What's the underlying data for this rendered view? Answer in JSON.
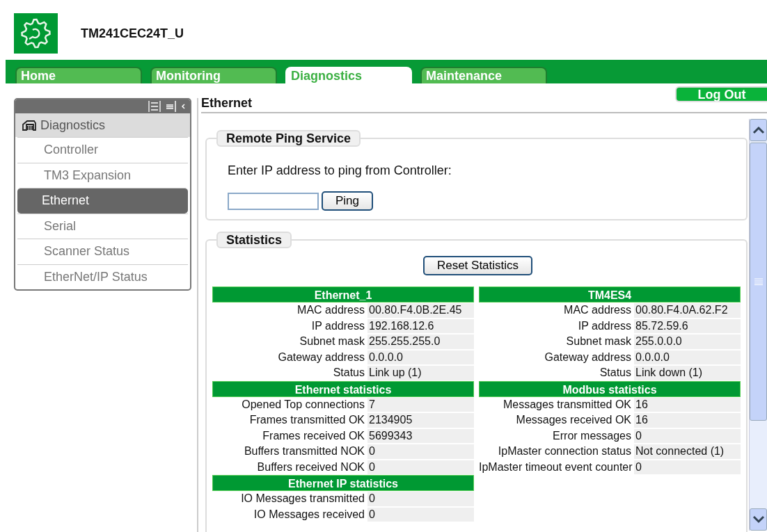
{
  "header": {
    "title": "TM241CEC24T_U"
  },
  "tabs": [
    {
      "label": "Home",
      "selected": false
    },
    {
      "label": "Monitoring",
      "selected": false
    },
    {
      "label": "Diagnostics",
      "selected": true
    },
    {
      "label": "Maintenance",
      "selected": false
    }
  ],
  "logout_button": "Log Out",
  "sidebar": {
    "heading": "Diagnostics",
    "items": [
      {
        "label": "Controller",
        "selected": false
      },
      {
        "label": "TM3 Expansion",
        "selected": false
      },
      {
        "label": "Ethernet",
        "selected": true
      },
      {
        "label": "Serial",
        "selected": false
      },
      {
        "label": "Scanner Status",
        "selected": false
      },
      {
        "label": "EtherNet/IP Status",
        "selected": false
      }
    ]
  },
  "page_title": "Ethernet",
  "ping": {
    "legend": "Remote Ping Service",
    "prompt": "Enter IP address to ping from Controller:",
    "button": "Ping"
  },
  "statistics": {
    "legend": "Statistics",
    "reset_button": "Reset Statistics",
    "columns": [
      {
        "sections": [
          {
            "title": "Ethernet_1",
            "rows": [
              {
                "label": "MAC address",
                "value": "00.80.F4.0B.2E.45"
              },
              {
                "label": "IP address",
                "value": "192.168.12.6"
              },
              {
                "label": "Subnet mask",
                "value": "255.255.255.0"
              },
              {
                "label": "Gateway address",
                "value": "0.0.0.0"
              },
              {
                "label": "Status",
                "value": "Link up (1)"
              }
            ]
          },
          {
            "title": "Ethernet statistics",
            "rows": [
              {
                "label": "Opened Top connections",
                "value": "7"
              },
              {
                "label": "Frames transmitted OK",
                "value": "2134905"
              },
              {
                "label": "Frames received OK",
                "value": "5699343"
              },
              {
                "label": "Buffers transmitted NOK",
                "value": "0"
              },
              {
                "label": "Buffers received NOK",
                "value": "0"
              }
            ]
          },
          {
            "title": "Ethernet IP statistics",
            "rows": [
              {
                "label": "IO Messages transmitted",
                "value": "0"
              },
              {
                "label": "IO Messages received",
                "value": "0"
              }
            ]
          }
        ]
      },
      {
        "sections": [
          {
            "title": "TM4ES4",
            "rows": [
              {
                "label": "MAC address",
                "value": "00.80.F4.0A.62.F2"
              },
              {
                "label": "IP address",
                "value": "85.72.59.6"
              },
              {
                "label": "Subnet mask",
                "value": "255.0.0.0"
              },
              {
                "label": "Gateway address",
                "value": "0.0.0.0"
              },
              {
                "label": "Status",
                "value": "Link down (1)"
              }
            ]
          },
          {
            "title": "Modbus statistics",
            "rows": [
              {
                "label": "Messages transmitted OK",
                "value": "16"
              },
              {
                "label": "Messages received OK",
                "value": "16"
              },
              {
                "label": "Error messages",
                "value": "0"
              },
              {
                "label": "IpMaster connection status",
                "value": "Not connected (1)"
              },
              {
                "label": "IpMaster timeout event counter",
                "value": "0"
              }
            ]
          }
        ]
      }
    ]
  }
}
